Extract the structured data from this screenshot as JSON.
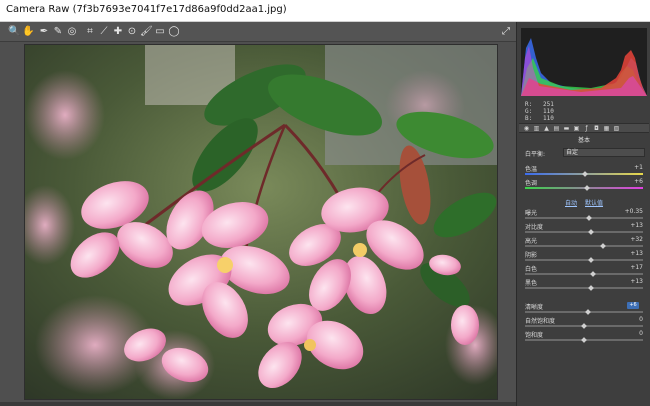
{
  "window": {
    "title": "Camera Raw (7f3b7693e7041f7e17d86a9f0dd2aa1.jpg)"
  },
  "toolbar": {
    "tools": [
      {
        "name": "zoom-tool-icon",
        "glyph": "🔍"
      },
      {
        "name": "hand-tool-icon",
        "glyph": "✋"
      },
      {
        "name": "white-balance-tool-icon",
        "glyph": "✒"
      },
      {
        "name": "color-sampler-tool-icon",
        "glyph": "✎"
      },
      {
        "name": "target-adjustment-tool-icon",
        "glyph": "◎"
      },
      {
        "name": "crop-tool-icon",
        "glyph": "⌗"
      },
      {
        "name": "straighten-tool-icon",
        "glyph": "⟋"
      },
      {
        "name": "spot-removal-tool-icon",
        "glyph": "✚"
      },
      {
        "name": "red-eye-tool-icon",
        "glyph": "⊙"
      },
      {
        "name": "adjustment-brush-icon",
        "glyph": "🖌"
      },
      {
        "name": "graduated-filter-icon",
        "glyph": "▭"
      },
      {
        "name": "radial-filter-icon",
        "glyph": "◯"
      }
    ],
    "fullscreen_glyph": "⤢"
  },
  "histogram": {
    "colors": {
      "red": "#e8443a",
      "green": "#3ad24a",
      "blue": "#3a6cf0",
      "magenta": "#e040e0"
    }
  },
  "readout": {
    "r_label": "R:",
    "r": "251",
    "g_label": "G:",
    "g": "110",
    "b_label": "B:",
    "b": "110"
  },
  "panel": {
    "section_title": "基本",
    "white_balance": {
      "label": "白平衡:",
      "value": "自定"
    },
    "temperature": {
      "label": "色温",
      "value": "+1"
    },
    "tint": {
      "label": "色调",
      "value": "+6"
    },
    "auto_link": "自动",
    "default_link": "默认值",
    "sliders": [
      {
        "label": "曝光",
        "value": "+0.35",
        "level": 0.54
      },
      {
        "label": "对比度",
        "value": "+13",
        "level": 0.56
      },
      {
        "label": "高光",
        "value": "+32",
        "level": 0.66
      },
      {
        "label": "阴影",
        "value": "+13",
        "level": 0.56
      },
      {
        "label": "白色",
        "value": "+17",
        "level": 0.58
      },
      {
        "label": "黑色",
        "value": "+13",
        "level": 0.56
      }
    ],
    "presence": [
      {
        "label": "清晰度",
        "value": "+6",
        "level": 0.53
      },
      {
        "label": "自然饱和度",
        "value": "0",
        "level": 0.5
      },
      {
        "label": "饱和度",
        "value": "0",
        "level": 0.5
      }
    ]
  }
}
